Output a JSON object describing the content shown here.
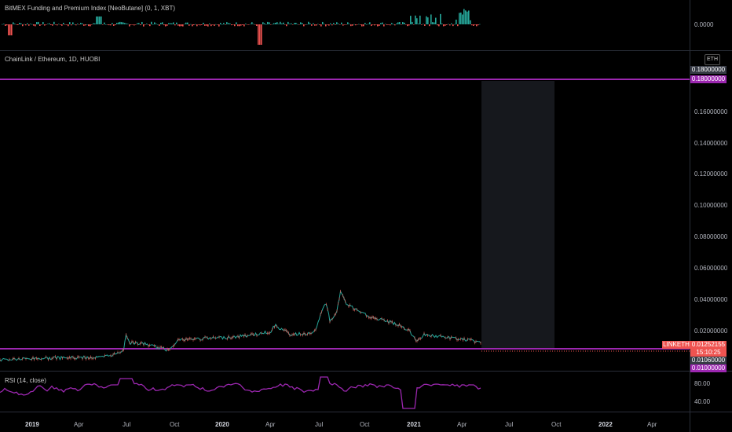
{
  "funding_pane": {
    "legend": "BitMEX Funding and Premium Index [NeoButane] (0, 1, XBT)",
    "price_label": "0.0000"
  },
  "main_pane": {
    "legend": "ChainLink / Ethereum, 1D, HUOBI",
    "currency_button": "ETH",
    "price_labels": [
      "0.16000000",
      "0.14000000",
      "0.12000000",
      "0.10000000",
      "0.08000000",
      "0.06000000",
      "0.04000000",
      "0.02000000"
    ],
    "top_line_labels": [
      "0.18000000",
      "0.18000000"
    ],
    "symbol_tag": "LINKETH",
    "last_price": "0.01252155",
    "countdown": "15:10:25",
    "low_line_labels": [
      "0.01060000",
      "0.01000000"
    ]
  },
  "rsi_pane": {
    "legend": "RSI (14, close)",
    "price_labels": [
      "80.00",
      "40.00"
    ]
  },
  "time_axis": [
    {
      "label": "2019",
      "year": true
    },
    {
      "label": "Apr",
      "year": false
    },
    {
      "label": "Jul",
      "year": false
    },
    {
      "label": "Oct",
      "year": false
    },
    {
      "label": "2020",
      "year": true
    },
    {
      "label": "Apr",
      "year": false
    },
    {
      "label": "Jul",
      "year": false
    },
    {
      "label": "Oct",
      "year": false
    },
    {
      "label": "2021",
      "year": true
    },
    {
      "label": "Apr",
      "year": false
    },
    {
      "label": "Jul",
      "year": false
    },
    {
      "label": "Oct",
      "year": false
    },
    {
      "label": "2022",
      "year": true
    },
    {
      "label": "Apr",
      "year": false
    }
  ],
  "colors": {
    "background": "#000000",
    "up": "#26a69a",
    "down": "#ef5350",
    "horizontal_line": "#9c27b0",
    "rsi_line": "#9c27b0",
    "tag_purple": "#9c27b0",
    "tag_red": "#ef5350",
    "tag_gray": "#363a45"
  }
}
